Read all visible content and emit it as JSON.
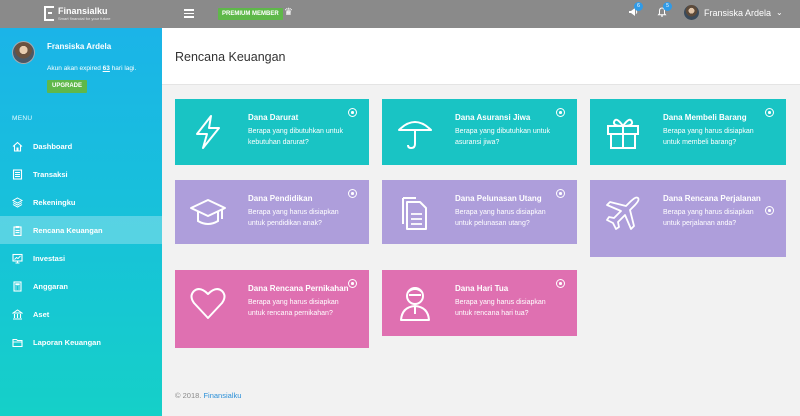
{
  "topbar": {
    "logo_text": "Finansialku",
    "logo_subtext": "Smart financial for your future",
    "premium_label": "PREMIUM MEMBER",
    "notifications": [
      {
        "icon": "megaphone-icon",
        "count": "6"
      },
      {
        "icon": "bell-icon",
        "count": "5"
      }
    ],
    "user_name": "Fransiska Ardela"
  },
  "sidebar": {
    "profile_name": "Fransiska Ardela",
    "expired_prefix": "Akun akan expired ",
    "expired_days": "63",
    "expired_suffix": " hari lagi.",
    "upgrade_label": "UPGRADE",
    "menu_heading": "MENU",
    "items": [
      {
        "label": "Dashboard",
        "icon": "home-icon",
        "active": false
      },
      {
        "label": "Transaksi",
        "icon": "ledger-icon",
        "active": false
      },
      {
        "label": "Rekeningku",
        "icon": "layers-icon",
        "active": false
      },
      {
        "label": "Rencana Keuangan",
        "icon": "clipboard-icon",
        "active": true
      },
      {
        "label": "Investasi",
        "icon": "chart-board-icon",
        "active": false
      },
      {
        "label": "Anggaran",
        "icon": "calculator-icon",
        "active": false
      },
      {
        "label": "Aset",
        "icon": "building-icon",
        "active": false
      },
      {
        "label": "Laporan Keuangan",
        "icon": "folder-icon",
        "active": false
      }
    ]
  },
  "main": {
    "page_title": "Rencana Keuangan",
    "cards": [
      {
        "title": "Dana Darurat",
        "desc": "Berapa yang dibutuhkan untuk kebutuhan darurat?",
        "icon": "lightning-icon",
        "color": "#19c4c4"
      },
      {
        "title": "Dana Asuransi Jiwa",
        "desc": "Berapa yang dibutuhkan untuk asuransi jiwa?",
        "icon": "umbrella-icon",
        "color": "#19c4c4"
      },
      {
        "title": "Dana Membeli Barang",
        "desc": "Berapa yang harus disiapkan untuk membeli barang?",
        "icon": "gift-icon",
        "color": "#19c4c4"
      },
      {
        "title": "Dana Pendidikan",
        "desc": "Berapa yang harus disiapkan untuk pendidikan anak?",
        "icon": "graduation-cap-icon",
        "color": "#ae9edb"
      },
      {
        "title": "Dana Pelunasan Utang",
        "desc": "Berapa yang harus disiapkan untuk pelunasan utang?",
        "icon": "documents-icon",
        "color": "#ae9edb"
      },
      {
        "title": "Dana Rencana Perjalanan",
        "desc": "Berapa yang harus disiapkan untuk perjalanan anda?",
        "icon": "airplane-icon",
        "color": "#ae9edb"
      },
      {
        "title": "Dana Rencana Pernikahan",
        "desc": "Berapa yang harus disiapkan untuk rencana pernikahan?",
        "icon": "heart-icon",
        "color": "#df70b1"
      },
      {
        "title": "Dana Hari Tua",
        "desc": "Berapa yang harus disiapkan untuk rencana hari tua?",
        "icon": "elderly-person-icon",
        "color": "#df70b1"
      }
    ],
    "footer_prefix": "© 2018. ",
    "footer_link": "Finansialku"
  }
}
